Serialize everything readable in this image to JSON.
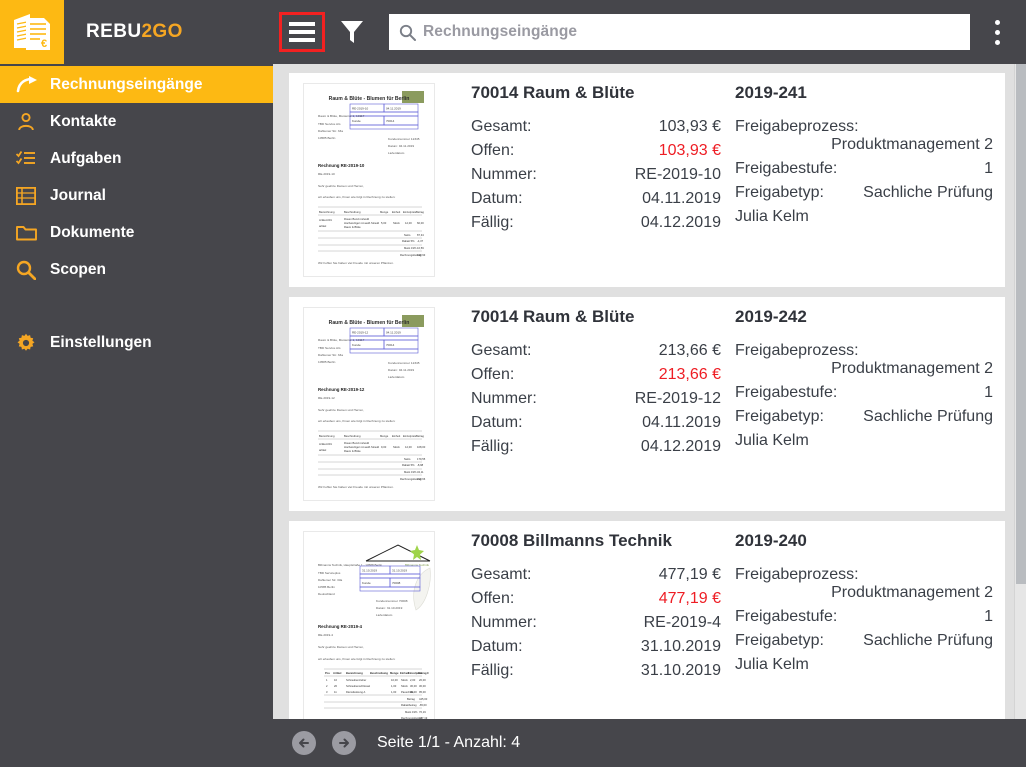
{
  "brand": {
    "white_part": "REBU",
    "orange_part": "2GO",
    "logo_icon": "documents-euro-icon"
  },
  "header": {
    "menu_icon": "hamburger-menu-icon",
    "filter_icon": "funnel-filter-icon",
    "overflow_icon": "kebab-menu-icon",
    "search": {
      "icon": "search-icon",
      "placeholder": "Rechnungseingänge",
      "value": ""
    },
    "highlight_color": "#f32121"
  },
  "sidebar": {
    "items": [
      {
        "label": "Rechnungseingänge",
        "icon": "arrow-incoming-icon",
        "active": true
      },
      {
        "label": "Kontakte",
        "icon": "person-icon",
        "active": false
      },
      {
        "label": "Aufgaben",
        "icon": "checklist-icon",
        "active": false
      },
      {
        "label": "Journal",
        "icon": "table-list-icon",
        "active": false
      },
      {
        "label": "Dokumente",
        "icon": "folder-icon",
        "active": false
      },
      {
        "label": "Scopen",
        "icon": "magnifier-icon",
        "active": false
      }
    ],
    "settings": {
      "label": "Einstellungen",
      "icon": "gear-icon"
    }
  },
  "colors": {
    "accent": "#fdb913",
    "chrome": "#46464b",
    "content_bg": "#e0e0e0",
    "card_bg": "#ffffff",
    "open_amount": "#ee1d24",
    "annotation": "#f32121"
  },
  "labels": {
    "gesamt": "Gesamt:",
    "offen": "Offen:",
    "nummer": "Nummer:",
    "datum": "Datum:",
    "faellig": "Fällig:",
    "freigabeprozess": "Freigabeprozess:",
    "freigabestufe": "Freigabestufe:",
    "freigabetyp": "Freigabetyp:"
  },
  "cards": [
    {
      "title": "70014 Raum & Blüte",
      "reference": "2019-241",
      "gesamt": "103,93 €",
      "offen": "103,93 €",
      "nummer": "RE-2019-10",
      "datum": "04.11.2019",
      "faellig": "04.12.2019",
      "freigabeprozess": "Produktmanagement 2",
      "freigabestufe": "1",
      "freigabetyp": "Sachliche Prüfung",
      "bearbeiter": "Julia Kelm",
      "thumbnail": "invoice-preview-raum-bluete"
    },
    {
      "title": "70014 Raum & Blüte",
      "reference": "2019-242",
      "gesamt": "213,66 €",
      "offen": "213,66 €",
      "nummer": "RE-2019-12",
      "datum": "04.11.2019",
      "faellig": "04.12.2019",
      "freigabeprozess": "Produktmanagement 2",
      "freigabestufe": "1",
      "freigabetyp": "Sachliche Prüfung",
      "bearbeiter": "Julia Kelm",
      "thumbnail": "invoice-preview-raum-bluete"
    },
    {
      "title": "70008 Billmanns Technik",
      "reference": "2019-240",
      "gesamt": "477,19 €",
      "offen": "477,19 €",
      "nummer": "RE-2019-4",
      "datum": "31.10.2019",
      "faellig": "31.10.2019",
      "freigabeprozess": "Produktmanagement 2",
      "freigabestufe": "1",
      "freigabetyp": "Sachliche Prüfung",
      "bearbeiter": "Julia Kelm",
      "thumbnail": "invoice-preview-billmanns"
    }
  ],
  "footer": {
    "prev_icon": "arrow-left-circle-icon",
    "next_icon": "arrow-right-circle-icon",
    "status": "Seite 1/1 - Anzahl: 4"
  }
}
